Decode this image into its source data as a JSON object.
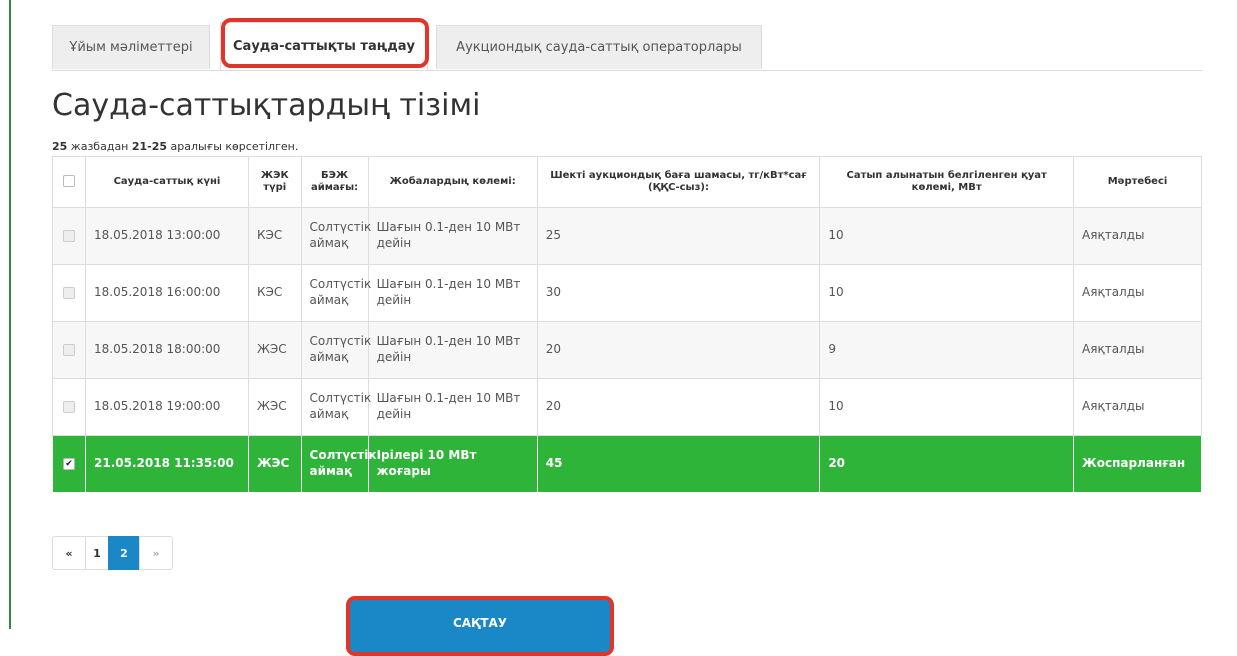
{
  "tabs": [
    {
      "label": "Ұйым мәліметтері"
    },
    {
      "label": "Сауда-саттықты таңдау"
    },
    {
      "label": "Аукциондық сауда-саттық операторлары"
    }
  ],
  "page_title": "Сауда-саттықтардың тізімі",
  "summary": {
    "total": "25",
    "text1": " жазбадан ",
    "range": "21-25",
    "text2": " аралығы көрсетілген."
  },
  "table": {
    "headers": [
      "Сауда-саттық күні",
      "ЖЭК түрі",
      "БЭЖ аймағы:",
      "Жобалардың көлемі:",
      "Шекті аукциондық баға шамасы, тг/кВт*сағ (ҚҚС-сыз):",
      "Сатып алынатын белгіленген қуат көлемі, МВт",
      "Мәртебесі"
    ],
    "rows": [
      {
        "date": "18.05.2018 13:00:00",
        "type": "КЭС",
        "zone": "Солтүстік аймақ",
        "volume": "Шағын 0.1-ден 10 МВт дейін",
        "price": "25",
        "capacity": "10",
        "status": "Аяқталды"
      },
      {
        "date": "18.05.2018 16:00:00",
        "type": "КЭС",
        "zone": "Солтүстік аймақ",
        "volume": "Шағын 0.1-ден 10 МВт дейін",
        "price": "30",
        "capacity": "10",
        "status": "Аяқталды"
      },
      {
        "date": "18.05.2018 18:00:00",
        "type": "ЖЭС",
        "zone": "Солтүстік аймақ",
        "volume": "Шағын 0.1-ден 10 МВт дейін",
        "price": "20",
        "capacity": "9",
        "status": "Аяқталды"
      },
      {
        "date": "18.05.2018 19:00:00",
        "type": "ЖЭС",
        "zone": "Солтүстік аймақ",
        "volume": "Шағын 0.1-ден 10 МВт дейін",
        "price": "20",
        "capacity": "10",
        "status": "Аяқталды"
      },
      {
        "date": "21.05.2018 11:35:00",
        "type": "ЖЭС",
        "zone": "Солтүстік аймақ",
        "volume": "Ірілері 10 МВт жоғары",
        "price": "45",
        "capacity": "20",
        "status": "Жоспарланған",
        "selected": true
      }
    ]
  },
  "pagination": {
    "prev": "«",
    "pages": [
      "1",
      "2"
    ],
    "next": "»",
    "current": "2"
  },
  "save_button": {
    "label": "САҚТАУ"
  },
  "colors": {
    "selected_row": "#2fb43a",
    "primary": "#1a88c6",
    "highlight": "#e0352b",
    "rule": "#2e8b3d"
  }
}
